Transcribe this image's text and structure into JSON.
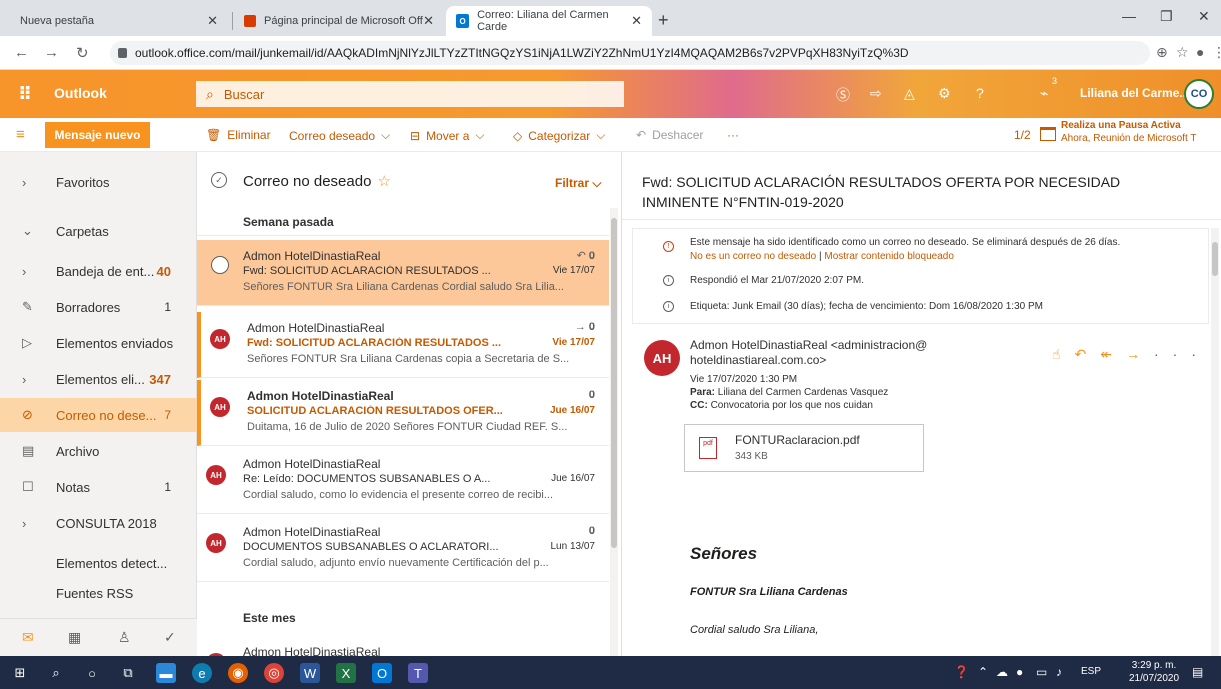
{
  "browser": {
    "tabs": [
      {
        "label": "Nueva pestaña"
      },
      {
        "label": "Página principal de Microsoft Off"
      },
      {
        "label": "Correo: Liliana del Carmen Carde"
      }
    ],
    "url": "outlook.office.com/mail/junkemail/id/AAQkADImNjNlYzJlLTYzZTItNGQzYS1iNjA1LWZiY2ZhNmU1YzI4MQAQAM2B6s7v2PVPqXH83NyiTzQ%3D"
  },
  "header": {
    "brand": "Outlook",
    "search_placeholder": "Buscar",
    "user_name": "Liliana del Carme..",
    "notification_count": "3",
    "avatar_text": "CO"
  },
  "commands": {
    "new_message": "Mensaje nuevo",
    "delete": "Eliminar",
    "wanted_mail": "Correo deseado",
    "move_to": "Mover a",
    "categorize": "Categorizar",
    "undo": "Deshacer",
    "more": "···",
    "pager": "1/2",
    "calendar_title": "Realiza una Pausa Activa",
    "calendar_sub": "Ahora, Reunión de Microsoft T"
  },
  "nav": {
    "items": [
      {
        "label": "Favoritos",
        "count": ""
      },
      {
        "label": "Carpetas",
        "count": ""
      },
      {
        "label": "Bandeja de ent...",
        "count": "40"
      },
      {
        "label": "Borradores",
        "count": "1"
      },
      {
        "label": "Elementos enviados",
        "count": ""
      },
      {
        "label": "Elementos eli...",
        "count": "347"
      },
      {
        "label": "Correo no dese...",
        "count": "7"
      },
      {
        "label": "Archivo",
        "count": ""
      },
      {
        "label": "Notas",
        "count": "1"
      },
      {
        "label": "CONSULTA 2018",
        "count": ""
      },
      {
        "label": "Elementos detect...",
        "count": ""
      },
      {
        "label": "Fuentes RSS",
        "count": ""
      }
    ]
  },
  "list": {
    "title": "Correo no deseado",
    "filter": "Filtrar",
    "groups": [
      "Semana pasada",
      "Este mes"
    ],
    "messages": [
      {
        "avatar": "",
        "from": "Admon HotelDinastiaReal",
        "subject": "Fwd: SOLICITUD ACLARACIÓN RESULTADOS ...",
        "date": "Vie 17/07",
        "preview": "Señores FONTUR Sra Liliana Cardenas Cordial saludo Sra Lilia..."
      },
      {
        "avatar": "AH",
        "from": "Admon HotelDinastiaReal",
        "subject": "Fwd: SOLICITUD ACLARACIÓN RESULTADOS ...",
        "date": "Vie 17/07",
        "preview": "Señores FONTUR Sra Liliana Cardenas copia a Secretaria de S..."
      },
      {
        "avatar": "AH",
        "from": "Admon HotelDinastiaReal",
        "subject": "SOLICITUD ACLARACIÓN RESULTADOS OFER...",
        "date": "Jue 16/07",
        "preview": "Duitama, 16 de Julio de 2020 Señores FONTUR Ciudad REF. S..."
      },
      {
        "avatar": "AH",
        "from": "Admon HotelDinastiaReal",
        "subject": "Re: Leído: DOCUMENTOS SUBSANABLES O A...",
        "date": "Jue 16/07",
        "preview": "Cordial saludo, como lo evidencia el presente correo de recibi..."
      },
      {
        "avatar": "AH",
        "from": "Admon HotelDinastiaReal",
        "subject": "DOCUMENTOS SUBSANABLES O ACLARATORI...",
        "date": "Lun 13/07",
        "preview": "Cordial saludo, adjunto envío nuevamente Certificación del p..."
      },
      {
        "avatar": "AH",
        "from": "Admon HotelDinastiaReal",
        "subject": "",
        "date": "",
        "preview": ""
      }
    ]
  },
  "reading": {
    "subject": "Fwd: SOLICITUD ACLARACIÓN RESULTADOS OFERTA POR NECESIDAD INMINENTE N°FNTIN-019-2020",
    "junk_notice": "Este mensaje ha sido identificado como un correo no deseado. Se eliminará después de 26 días.",
    "not_junk": "No es un correo no deseado",
    "separator": "|",
    "show_blocked": "Mostrar contenido bloqueado",
    "replied": "Respondió el Mar 21/07/2020 2:07 PM.",
    "tag": "Etiqueta: Junk Email (30 días); fecha de vencimiento: Dom 16/08/2020 1:30 PM",
    "sender_avatar": "AH",
    "sender": "Admon HotelDinastiaReal <administracion@ hoteldinastiareal.com.co>",
    "sent": "Vie 17/07/2020 1:30 PM",
    "to_label": "Para:",
    "to": "Liliana del Carmen Cardenas Vasquez",
    "cc_label": "CC:",
    "cc": "Convocatoria por los que nos cuidan",
    "attachment_name": "FONTURaclaracion.pdf",
    "attachment_size": "343 KB",
    "body_greeting": "Señores",
    "body_line1": "FONTUR Sra Liliana Cardenas",
    "body_line2": "Cordial saludo Sra Liliana,"
  },
  "taskbar": {
    "lang": "ESP",
    "time": "3:29 p. m.",
    "date": "21/07/2020"
  },
  "colors": {
    "accent": "#f7931e",
    "accent_dark": "#c45a00",
    "selected": "#fcc89a"
  }
}
